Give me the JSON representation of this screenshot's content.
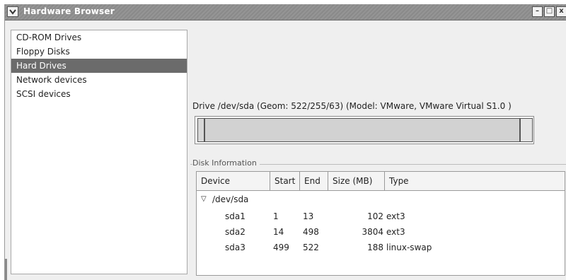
{
  "window": {
    "title": "Hardware Browser",
    "controls": {
      "minimize": "–",
      "maximize": "□",
      "close": "x"
    }
  },
  "sidebar": {
    "items": [
      {
        "label": "CD-ROM Drives",
        "selected": false
      },
      {
        "label": "Floppy Disks",
        "selected": false
      },
      {
        "label": "Hard Drives",
        "selected": true
      },
      {
        "label": "Network devices",
        "selected": false
      },
      {
        "label": "SCSI devices",
        "selected": false
      }
    ]
  },
  "drive": {
    "label": "Drive /dev/sda (Geom: 522/255/63) (Model: VMware, VMware Virtual S1.0 )"
  },
  "disk_info": {
    "label": "Disk Information",
    "columns": [
      "Device",
      "Start",
      "End",
      "Size (MB)",
      "Type"
    ],
    "parent": {
      "device": "/dev/sda"
    },
    "partitions": [
      {
        "device": "sda1",
        "start": "1",
        "end": "13",
        "size": "102",
        "type": "ext3"
      },
      {
        "device": "sda2",
        "start": "14",
        "end": "498",
        "size": "3804",
        "type": "ext3"
      },
      {
        "device": "sda3",
        "start": "499",
        "end": "522",
        "size": "188",
        "type": "linux-swap"
      }
    ]
  },
  "colors": {
    "selected_bg": "#6b6b6b",
    "titlebar": "#8a8a8a"
  }
}
